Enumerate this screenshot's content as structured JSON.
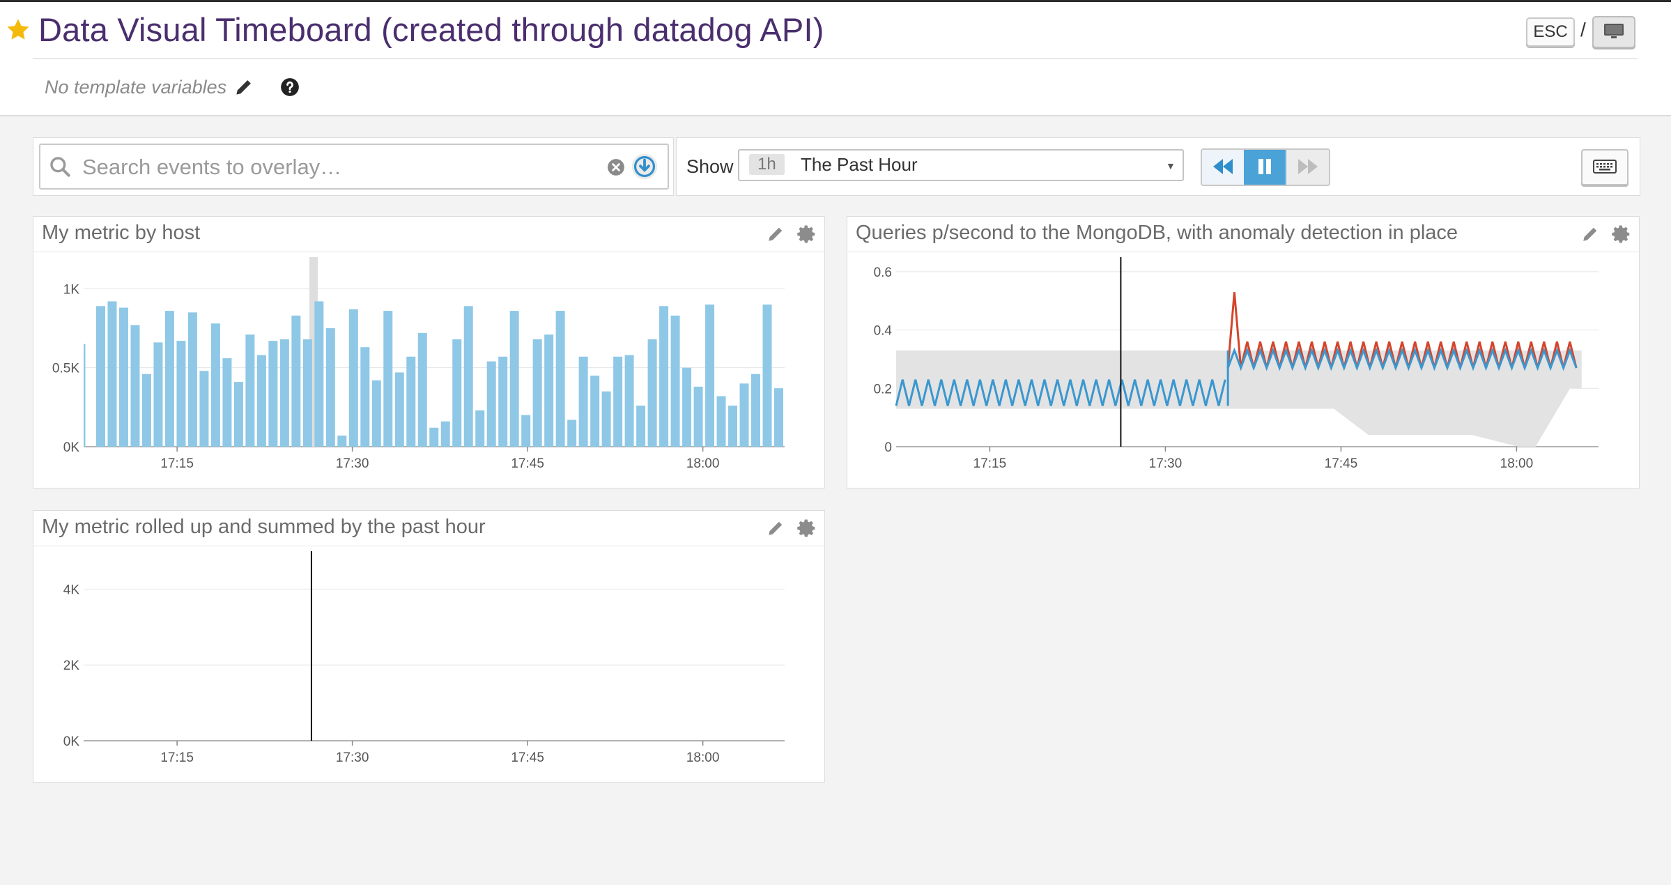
{
  "header": {
    "title": "Data Visual Timeboard (created through datadog API)",
    "esc_label": "ESC",
    "separator": "/",
    "template_variables_text": "No template variables"
  },
  "search": {
    "placeholder": "Search events to overlay…"
  },
  "timeframe": {
    "show_label": "Show",
    "badge": "1h",
    "label": "The Past Hour"
  },
  "colors": {
    "title_purple": "#4a2e6e",
    "bar_blue": "#8ec8e6",
    "line_blue": "#3a97d0",
    "anomaly_red": "#d3452c",
    "band_gray": "#e3e3e3",
    "pause_active": "#4aa2d6",
    "star": "#f5b90a"
  },
  "widgets": [
    {
      "title": "My metric by host",
      "chart_data": {
        "type": "bar",
        "x_ticks": [
          "17:15",
          "17:30",
          "17:45",
          "18:00"
        ],
        "y_ticks": [
          "0K",
          "0.5K",
          "1K"
        ],
        "ylim": [
          0,
          1200
        ],
        "xlim_minutes": [
          0,
          60
        ],
        "tick_minutes": [
          8,
          23,
          38,
          53
        ],
        "values": [
          650,
          890,
          920,
          880,
          770,
          460,
          660,
          860,
          670,
          850,
          480,
          780,
          560,
          410,
          710,
          580,
          670,
          680,
          830,
          680,
          920,
          750,
          70,
          870,
          630,
          420,
          860,
          470,
          570,
          720,
          120,
          160,
          680,
          890,
          230,
          540,
          570,
          860,
          200,
          680,
          710,
          860,
          170,
          570,
          450,
          350,
          570,
          580,
          260,
          680,
          890,
          830,
          500,
          380,
          900,
          320,
          260,
          400,
          460,
          900,
          370
        ],
        "series_name": "My metric by host"
      }
    },
    {
      "title": "Queries p/second to the MongoDB, with anomaly detection in place",
      "chart_data": {
        "type": "line",
        "x_ticks": [
          "17:15",
          "17:30",
          "17:45",
          "18:00"
        ],
        "y_ticks": [
          "0",
          "0.2",
          "0.4",
          "0.6"
        ],
        "ylim": [
          0,
          0.65
        ],
        "xlim_minutes": [
          0,
          60
        ],
        "tick_minutes": [
          8,
          23,
          38,
          53
        ],
        "series": [
          {
            "name": "normal",
            "color": "#3a97d0",
            "low": 0.14,
            "high": 0.23,
            "from_minute": 0,
            "to_minute": 28.8
          },
          {
            "name": "normal_after",
            "color": "#3a97d0",
            "low": 0.27,
            "high": 0.33,
            "from_minute": 28.8,
            "to_minute": 59.5
          },
          {
            "name": "anomaly",
            "color": "#d3452c",
            "low": 0.27,
            "high": 0.36,
            "spike": 0.53,
            "spike_minute": 29.2,
            "from_minute": 28.8,
            "to_minute": 59.5
          }
        ],
        "band": [
          {
            "minute": 0,
            "low": 0.13,
            "high": 0.33
          },
          {
            "minute": 28.8,
            "low": 0.13,
            "high": 0.33
          },
          {
            "minute": 28.8,
            "low": 0.13,
            "high": 0.33
          },
          {
            "minute": 38,
            "low": 0.13,
            "high": 0.33
          },
          {
            "minute": 41,
            "low": 0.04,
            "high": 0.33
          },
          {
            "minute": 50,
            "low": 0.04,
            "high": 0.33
          },
          {
            "minute": 54,
            "low": 0.0,
            "high": 0.33
          },
          {
            "minute": 55.5,
            "low": 0.0,
            "high": 0.33
          },
          {
            "minute": 58.5,
            "low": 0.2,
            "high": 0.33
          },
          {
            "minute": 59.5,
            "low": 0.2,
            "high": 0.33
          }
        ],
        "cursor_minute": 19.5
      }
    },
    {
      "title": "My metric rolled up and summed by the past hour",
      "chart_data": {
        "type": "line",
        "x_ticks": [
          "17:15",
          "17:30",
          "17:45",
          "18:00"
        ],
        "y_ticks": [
          "0K",
          "2K",
          "4K"
        ],
        "ylim": [
          0,
          5000
        ],
        "xlim_minutes": [
          0,
          60
        ],
        "tick_minutes": [
          8,
          23,
          38,
          53
        ],
        "spike_minute": 19.5,
        "spike_value": 5500,
        "series": []
      }
    }
  ]
}
